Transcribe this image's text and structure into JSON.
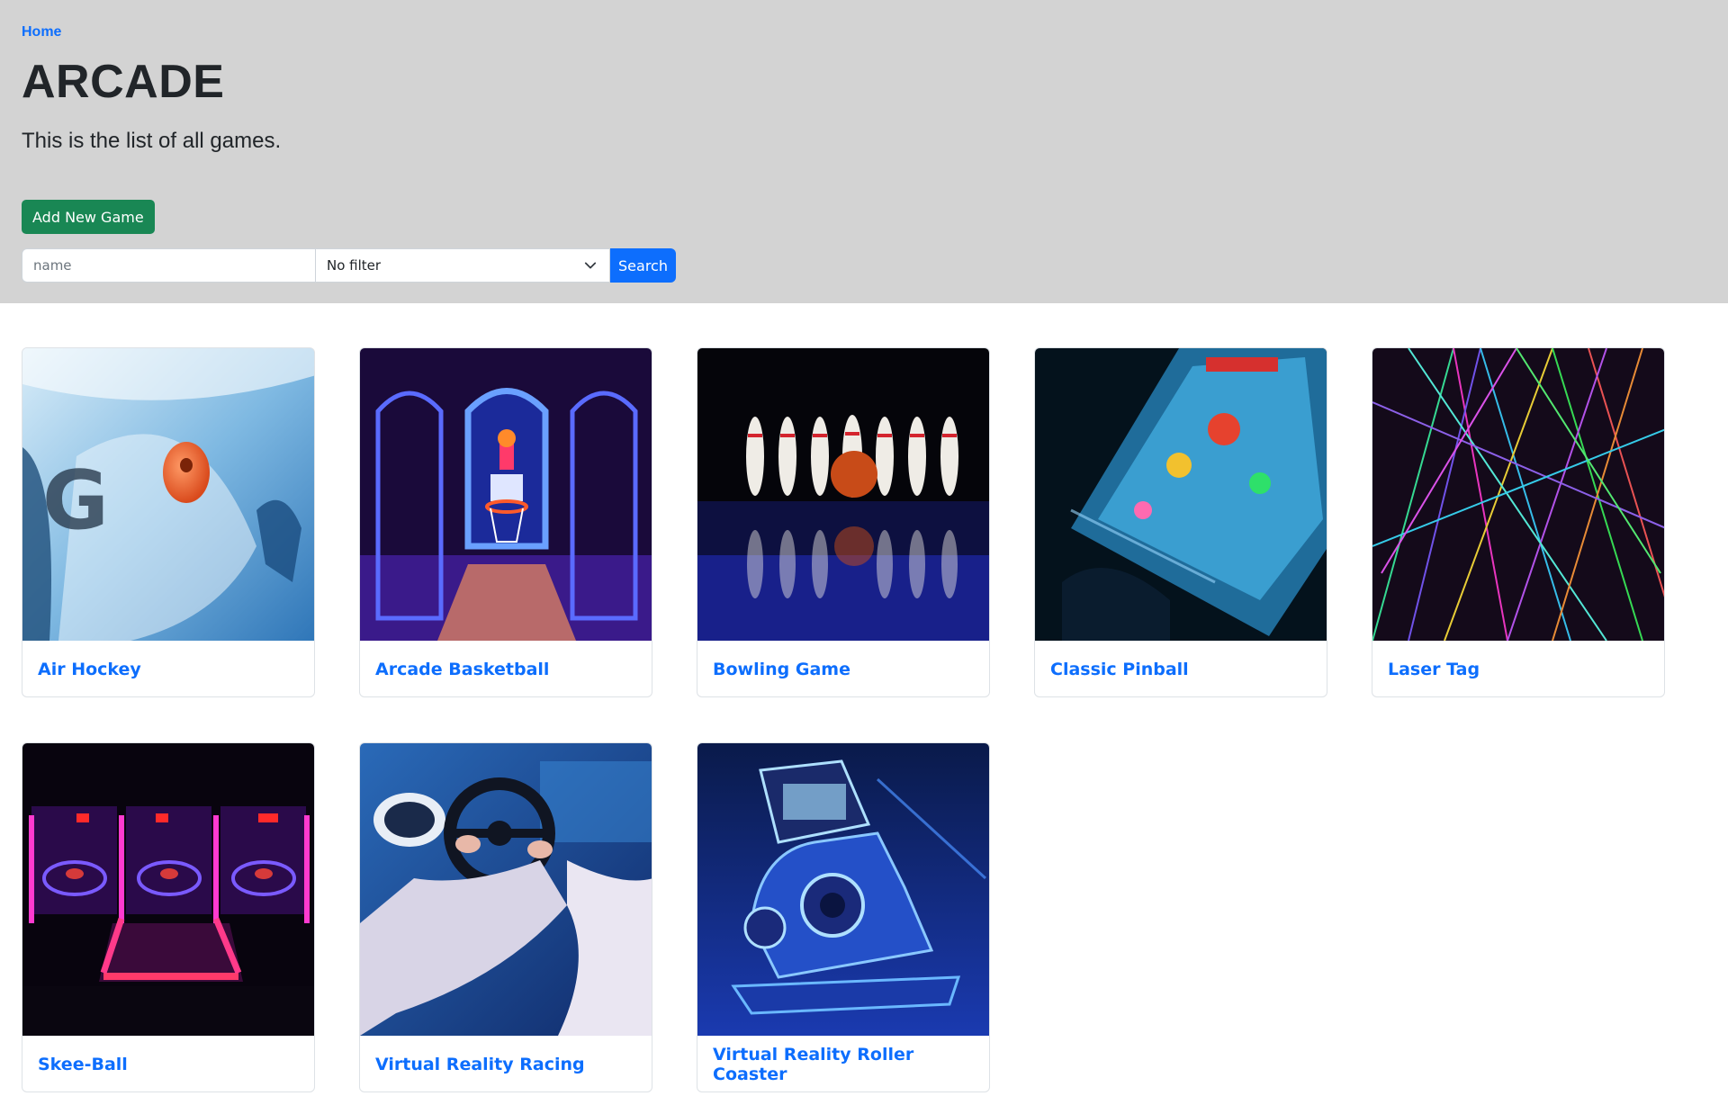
{
  "breadcrumb": {
    "home": "Home"
  },
  "header": {
    "title": "ARCADE",
    "subtitle": "This is the list of all games."
  },
  "actions": {
    "add_label": "Add New Game",
    "search_placeholder": "name",
    "filter_selected": "No filter",
    "search_label": "Search"
  },
  "games": [
    {
      "title": "Air Hockey",
      "image": "air-hockey-image"
    },
    {
      "title": "Arcade Basketball",
      "image": "arcade-basketball-image"
    },
    {
      "title": "Bowling Game",
      "image": "bowling-image"
    },
    {
      "title": "Classic Pinball",
      "image": "pinball-image"
    },
    {
      "title": "Laser Tag",
      "image": "laser-tag-image"
    },
    {
      "title": "Skee-Ball",
      "image": "skee-ball-image"
    },
    {
      "title": "Virtual Reality Racing",
      "image": "vr-racing-image"
    },
    {
      "title": "Virtual Reality Roller Coaster",
      "image": "vr-coaster-image"
    }
  ],
  "colors": {
    "accent": "#0d6efd",
    "success": "#198754",
    "hero_bg": "#d3d3d3"
  }
}
